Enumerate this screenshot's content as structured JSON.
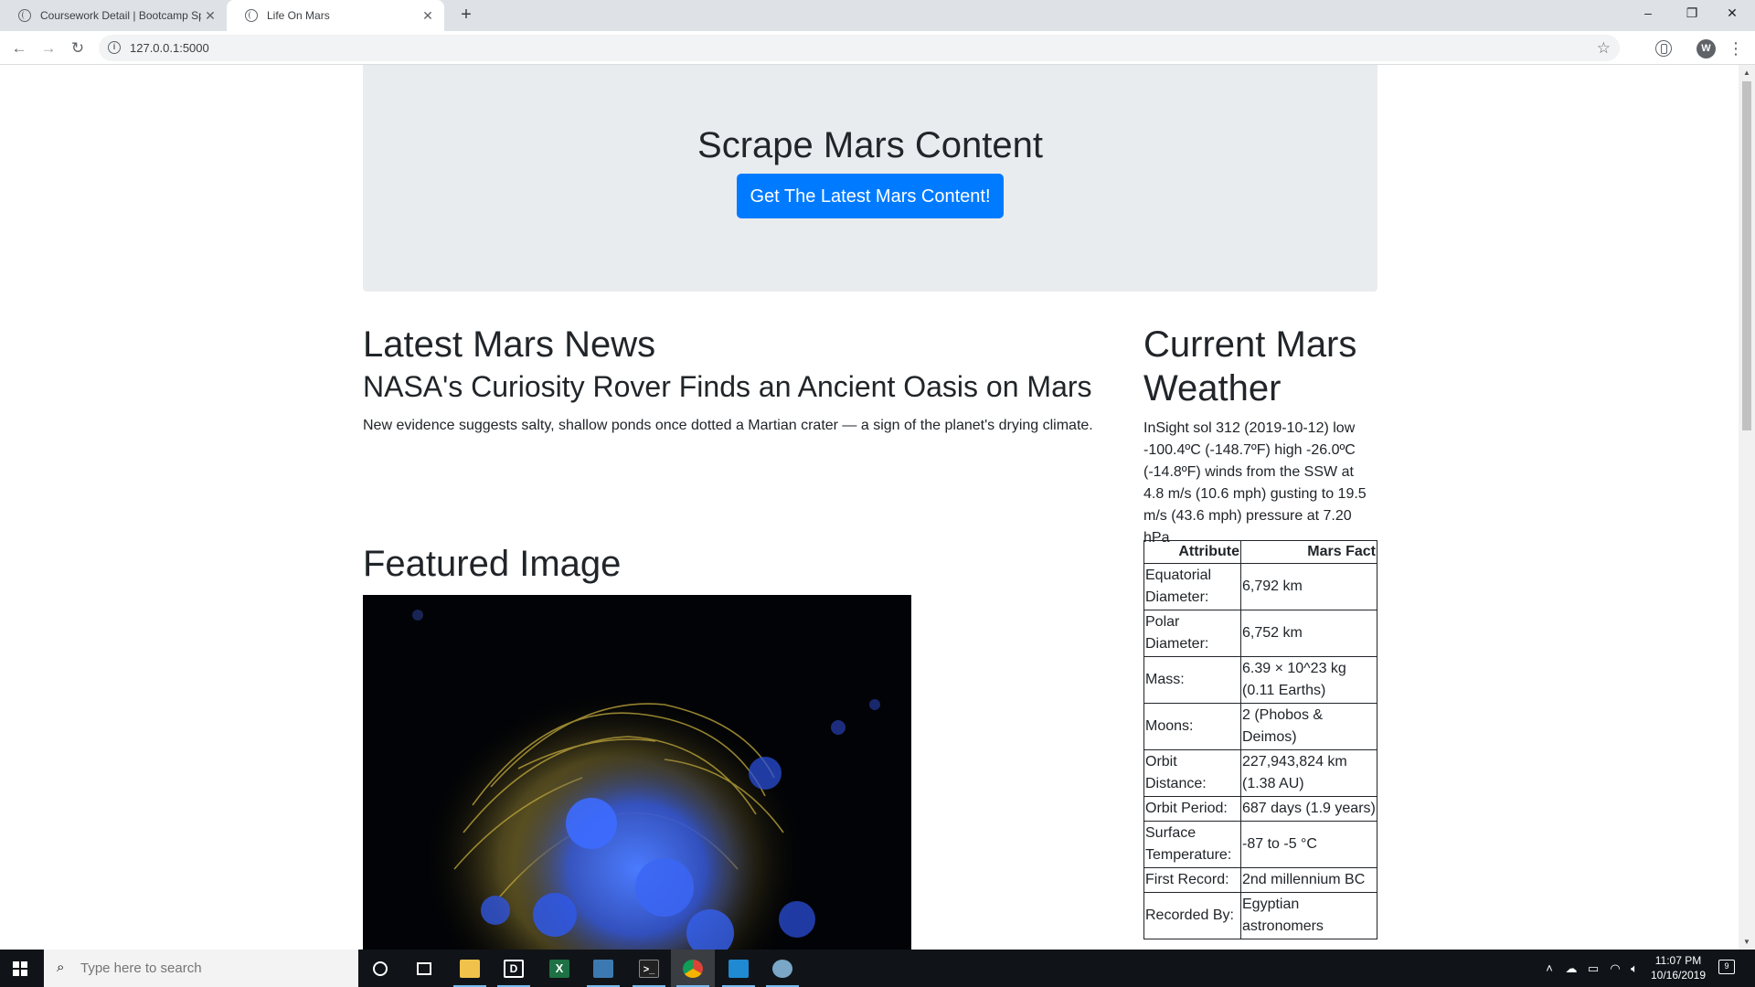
{
  "browser": {
    "tabs": [
      {
        "title": "Coursework Detail | Bootcamp Sp",
        "active": false
      },
      {
        "title": "Life On Mars",
        "active": true
      }
    ],
    "new_tab_label": "+",
    "url": "127.0.0.1:5000",
    "profile_initial": "W",
    "window_controls": {
      "minimize": "–",
      "restore": "❐",
      "close": "✕"
    }
  },
  "page": {
    "jumbotron": {
      "title": "Scrape Mars Content",
      "button_label": "Get The Latest Mars Content!"
    },
    "news": {
      "heading": "Latest Mars News",
      "title": "NASA's Curiosity Rover Finds an Ancient Oasis on Mars",
      "paragraph": "New evidence suggests salty, shallow ponds once dotted a Martian crater — a sign of the planet's drying climate."
    },
    "featured": {
      "heading": "Featured Image"
    },
    "weather": {
      "heading": "Current Mars Weather",
      "text": "InSight sol 312 (2019-10-12) low -100.4ºC (-148.7ºF) high -26.0ºC (-14.8ºF) winds from the SSW at 4.8 m/s (10.6 mph) gusting to 19.5 m/s (43.6 mph) pressure at 7.20 hPa"
    },
    "facts": {
      "headers": [
        "Attribute",
        "Mars Fact"
      ],
      "rows": [
        [
          "Equatorial Diameter:",
          "6,792 km"
        ],
        [
          "Polar Diameter:",
          "6,752 km"
        ],
        [
          "Mass:",
          "6.39 × 10^23 kg (0.11 Earths)"
        ],
        [
          "Moons:",
          "2 (Phobos & Deimos)"
        ],
        [
          "Orbit Distance:",
          "227,943,824 km (1.38 AU)"
        ],
        [
          "Orbit Period:",
          "687 days (1.9 years)"
        ],
        [
          "Surface Temperature:",
          "-87 to -5 °C"
        ],
        [
          "First Record:",
          "2nd millennium BC"
        ],
        [
          "Recorded By:",
          "Egyptian astronomers"
        ]
      ]
    }
  },
  "taskbar": {
    "search_placeholder": "Type here to search",
    "time": "11:07 PM",
    "date": "10/16/2019",
    "notification_count": "9",
    "apps": [
      "cortana-icon",
      "task-view-icon",
      "file-explorer-icon",
      "dell-icon",
      "excel-icon",
      "python-icon",
      "terminal-icon",
      "chrome-icon",
      "vscode-icon",
      "paint-icon"
    ]
  },
  "colors": {
    "primary": "#007bff",
    "jumbotron_bg": "#e9ecef",
    "taskbar_bg": "#101418"
  }
}
